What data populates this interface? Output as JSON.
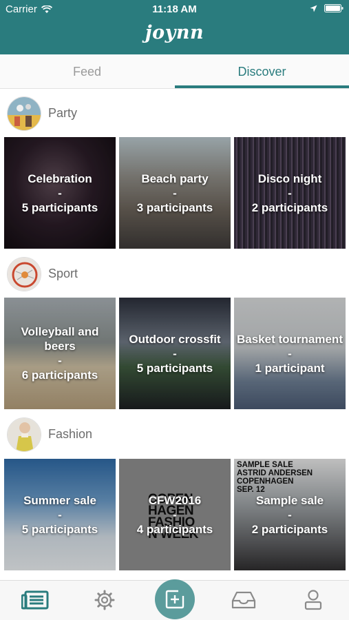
{
  "status_bar": {
    "carrier": "Carrier",
    "time": "11:18 AM"
  },
  "app": {
    "title": "joynn"
  },
  "tabs": [
    {
      "label": "Feed",
      "active": false
    },
    {
      "label": "Discover",
      "active": true
    }
  ],
  "sections": [
    {
      "title": "Party",
      "events": [
        {
          "name": "Celebration",
          "separator": "-",
          "participants": "5 participants"
        },
        {
          "name": "Beach party",
          "separator": "-",
          "participants": "3 participants"
        },
        {
          "name": "Disco night",
          "separator": "-",
          "participants": "2 participants"
        }
      ]
    },
    {
      "title": "Sport",
      "events": [
        {
          "name": "Volleyball and beers",
          "separator": "-",
          "participants": "6 participants"
        },
        {
          "name": "Outdoor crossfit",
          "separator": "-",
          "participants": "5 participants"
        },
        {
          "name": "Basket tournament",
          "separator": "-",
          "participants": "1 participant"
        }
      ]
    },
    {
      "title": "Fashion",
      "events": [
        {
          "name": "Summer sale",
          "separator": "-",
          "participants": "5 participants"
        },
        {
          "name": "CFW2016",
          "separator": "-",
          "participants": "4 participants"
        },
        {
          "name": "Sample sale",
          "separator": "-",
          "participants": "2 participants"
        }
      ]
    }
  ],
  "tile_artwork_text": {
    "cfw_poster": [
      "COPEN",
      "HAGEN",
      "FASHIO",
      "N WEEK"
    ],
    "sample_sale_poster": [
      "SAMPLE SALE",
      "ASTRID ANDERSEN",
      "COPENHAGEN",
      "SEP. 12"
    ]
  },
  "bottom_nav": [
    {
      "icon": "feed-list-icon",
      "active": true
    },
    {
      "icon": "gear-icon",
      "active": false
    },
    {
      "icon": "create-event-icon",
      "active": false
    },
    {
      "icon": "inbox-icon",
      "active": false
    },
    {
      "icon": "profile-icon",
      "active": false
    }
  ],
  "colors": {
    "brand": "#2a7c7e",
    "tab_inactive": "#9a9a9a",
    "fab": "#5b9c9c"
  }
}
